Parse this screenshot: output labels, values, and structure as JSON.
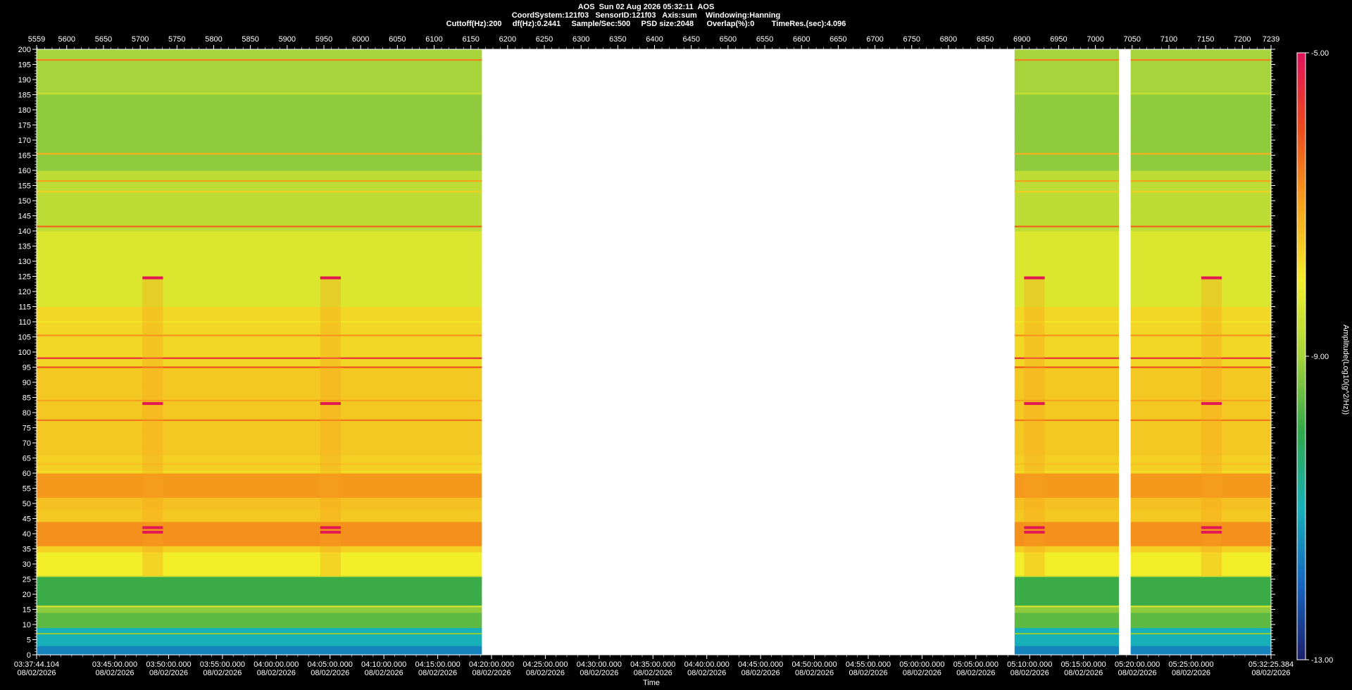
{
  "header": {
    "line1": "AOS  Sun 02 Aug 2026 05:32:11  AOS",
    "line2": "CoordSystem:121f03   SensorID:121f03   Axis:sum    Windowing:Hanning",
    "line3": "Cuttoff(Hz):200     df(Hz):0.2441     Sample/Sec:500     PSD size:2048      Overlap(%):0        TimeRes.(sec):4.096"
  },
  "chart_data": {
    "type": "heatmap",
    "subtype": "spectrogram",
    "xlabel": "Time",
    "colorbar_label": "Amplitude(Log10(g^2/Hz))",
    "colormap": [
      "#1b1f6b",
      "#1565c0",
      "#17b0b8",
      "#2fa84a",
      "#a6d43a",
      "#f2ee2a",
      "#f6a21c",
      "#ec4a1c",
      "#e0125a"
    ],
    "colorbar": {
      "min": -13,
      "max": -5,
      "tick_labels": [
        "-5.00",
        "-9.00",
        "-13.00"
      ]
    },
    "y_axis": {
      "min": 0,
      "max": 200,
      "unit": "Hz",
      "tick_labels": [
        "200",
        "195",
        "190",
        "185",
        "180",
        "175",
        "170",
        "165",
        "160",
        "155",
        "150",
        "145",
        "140",
        "135",
        "130",
        "125",
        "120",
        "115",
        "110",
        "105",
        "100",
        "95",
        "90",
        "85",
        "80",
        "75",
        "70",
        "65",
        "60",
        "55",
        "50",
        "45",
        "40",
        "35",
        "30",
        "25",
        "20",
        "15",
        "10",
        "5",
        "0"
      ]
    },
    "top_axis": {
      "min": 5559,
      "max": 7239,
      "tick_labels": [
        "5559",
        "5600",
        "5650",
        "5700",
        "5750",
        "5800",
        "5850",
        "5900",
        "5950",
        "6000",
        "6050",
        "6100",
        "6150",
        "6200",
        "6250",
        "6300",
        "6350",
        "6400",
        "6450",
        "6500",
        "6550",
        "6600",
        "6650",
        "6700",
        "6750",
        "6800",
        "6850",
        "6900",
        "6950",
        "7000",
        "7050",
        "7100",
        "7150",
        "7200",
        "7239"
      ]
    },
    "time_axis": {
      "start": "03:37:44.104",
      "end": "05:32:25.384",
      "tick_labels": [
        {
          "time": "03:37:44.104",
          "date": "08/02/2026"
        },
        {
          "time": "03:45:00.000",
          "date": "08/02/2026"
        },
        {
          "time": "03:50:00.000",
          "date": "08/02/2026"
        },
        {
          "time": "03:55:00.000",
          "date": "08/02/2026"
        },
        {
          "time": "04:00:00.000",
          "date": "08/02/2026"
        },
        {
          "time": "04:05:00.000",
          "date": "08/02/2026"
        },
        {
          "time": "04:10:00.000",
          "date": "08/02/2026"
        },
        {
          "time": "04:15:00.000",
          "date": "08/02/2026"
        },
        {
          "time": "04:20:00.000",
          "date": "08/02/2026"
        },
        {
          "time": "04:25:00.000",
          "date": "08/02/2026"
        },
        {
          "time": "04:30:00.000",
          "date": "08/02/2026"
        },
        {
          "time": "04:35:00.000",
          "date": "08/02/2026"
        },
        {
          "time": "04:40:00.000",
          "date": "08/02/2026"
        },
        {
          "time": "04:45:00.000",
          "date": "08/02/2026"
        },
        {
          "time": "04:50:00.000",
          "date": "08/02/2026"
        },
        {
          "time": "04:55:00.000",
          "date": "08/02/2026"
        },
        {
          "time": "05:00:00.000",
          "date": "08/02/2026"
        },
        {
          "time": "05:05:00.000",
          "date": "08/02/2026"
        },
        {
          "time": "05:10:00.000",
          "date": "08/02/2026"
        },
        {
          "time": "05:15:00.000",
          "date": "08/02/2026"
        },
        {
          "time": "05:20:00.000",
          "date": "08/02/2026"
        },
        {
          "time": "05:25:00.000",
          "date": "08/02/2026"
        },
        {
          "time": "05:32:25.384",
          "date": "08/02/2026"
        }
      ]
    },
    "data_segments": [
      {
        "start_index": 5559,
        "end_index": 6165
      },
      {
        "start_index": 6890,
        "end_index": 7032
      },
      {
        "start_index": 7048,
        "end_index": 7239
      }
    ],
    "tonal_lines_hz": [
      {
        "freq": 196.5,
        "level": -6.6
      },
      {
        "freq": 185.5,
        "level": -8.6
      },
      {
        "freq": 165.5,
        "level": -7.2
      },
      {
        "freq": 156.5,
        "level": -7.0
      },
      {
        "freq": 153,
        "level": -7.6
      },
      {
        "freq": 141.5,
        "level": -6.3
      },
      {
        "freq": 110,
        "level": -7.9
      },
      {
        "freq": 105.5,
        "level": -6.8
      },
      {
        "freq": 98,
        "level": -5.5
      },
      {
        "freq": 95,
        "level": -6.1
      },
      {
        "freq": 84,
        "level": -7.0
      },
      {
        "freq": 77.5,
        "level": -6.5
      },
      {
        "freq": 63,
        "level": -7.4
      },
      {
        "freq": 60.5,
        "level": -7.8
      },
      {
        "freq": 26,
        "level": -8.4
      },
      {
        "freq": 16,
        "level": -8.4
      },
      {
        "freq": 7,
        "level": -9.2
      }
    ],
    "event_bursts": [
      {
        "start_index": 5703,
        "end_index": 5731,
        "freqs_hz": [
          124.5,
          83,
          42,
          40.5
        ]
      },
      {
        "start_index": 5945,
        "end_index": 5973,
        "freqs_hz": [
          124.5,
          83,
          42,
          40.5
        ]
      },
      {
        "start_index": 6903,
        "end_index": 6931,
        "freqs_hz": [
          124.5,
          83,
          42,
          40.5
        ]
      },
      {
        "start_index": 7144,
        "end_index": 7172,
        "freqs_hz": [
          124.5,
          83,
          42,
          40.5
        ]
      }
    ]
  }
}
